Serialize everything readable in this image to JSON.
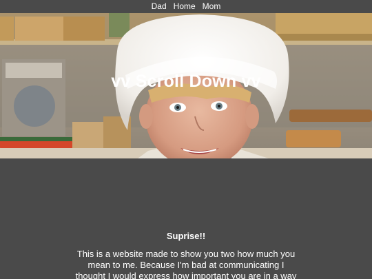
{
  "nav": {
    "items": [
      "Dad",
      "Home",
      "Mom"
    ]
  },
  "hero": {
    "title": "vv Scroll Down vv"
  },
  "content": {
    "heading": "Suprise!!",
    "body": "This is a website made to show you two how much you mean to me. Because I'm bad at communicating I thought I would express how important you are in a way"
  },
  "colors": {
    "background": "#4a4a4a",
    "text": "#ffffff"
  }
}
